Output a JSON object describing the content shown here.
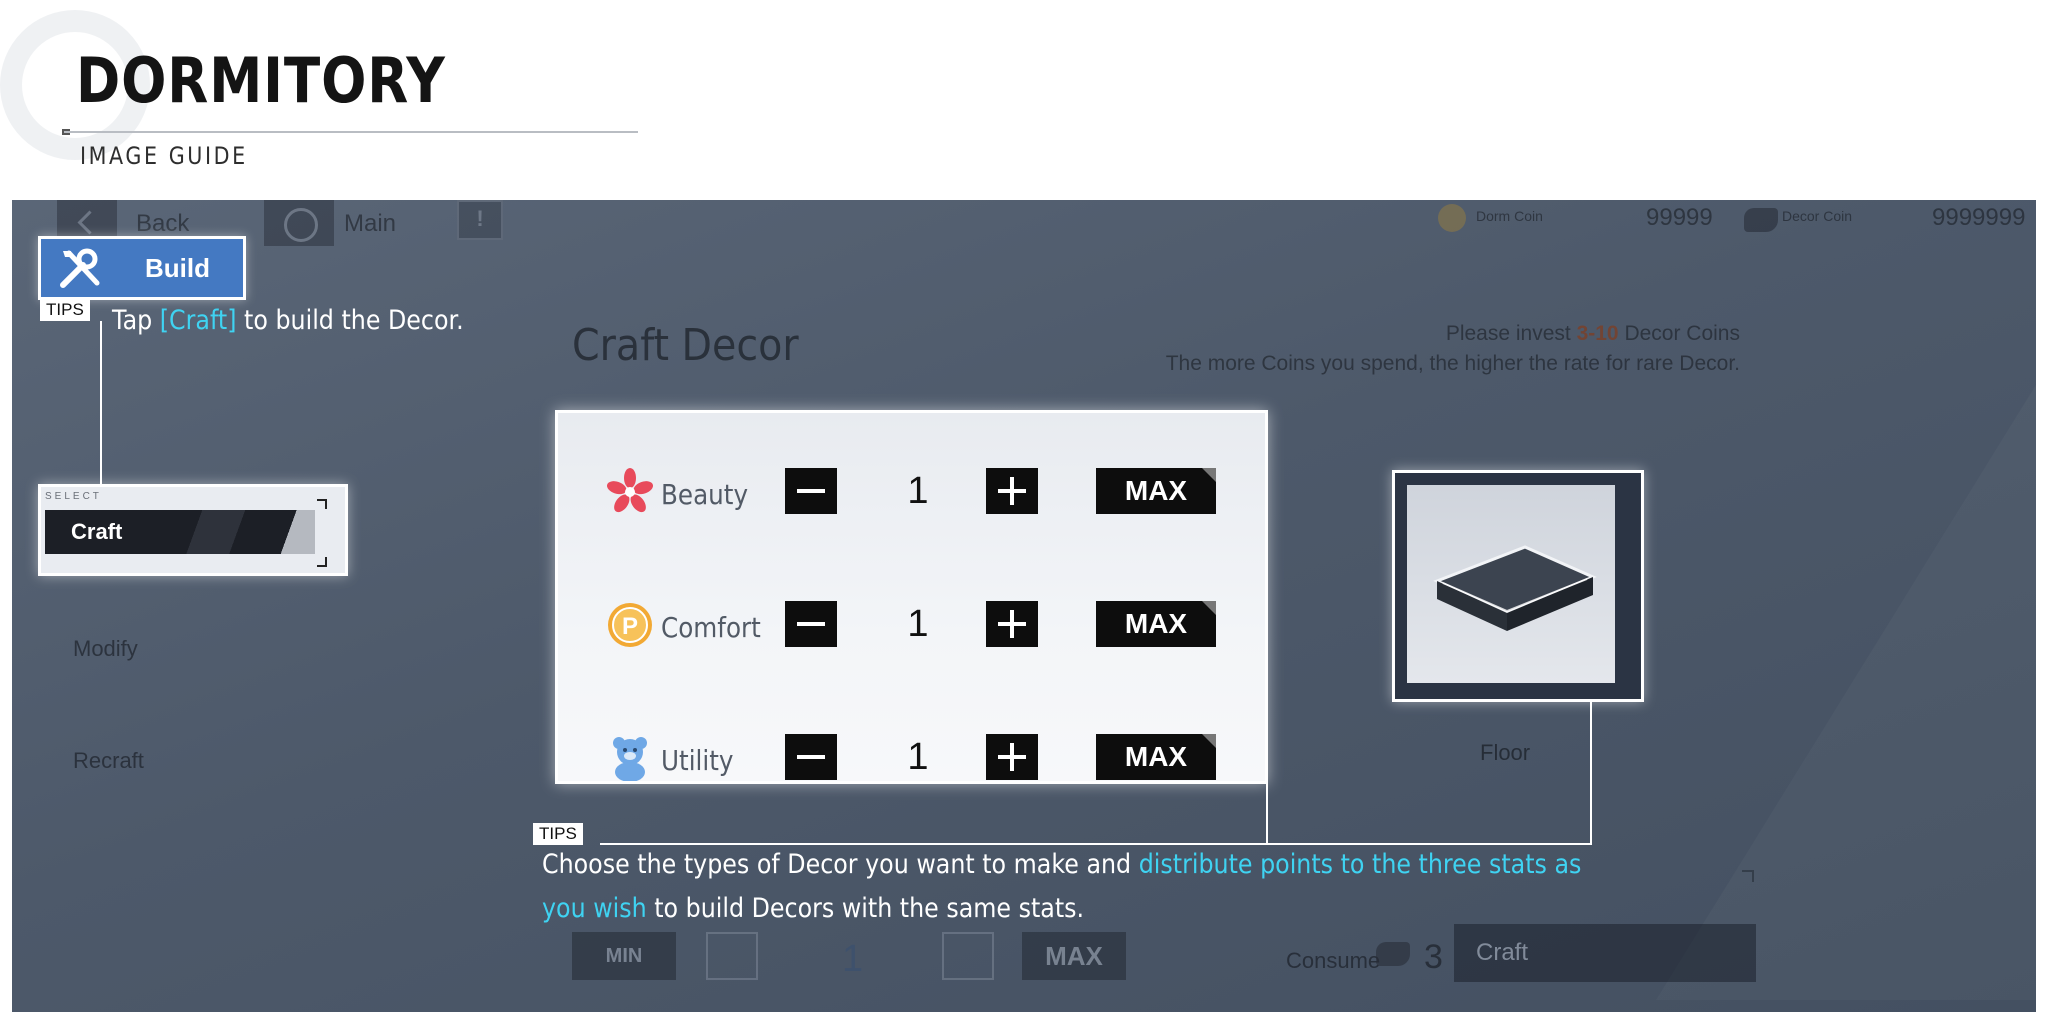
{
  "header": {
    "title": "DORMITORY",
    "subtitle": "IMAGE GUIDE"
  },
  "topbar": {
    "back_label": "Back",
    "main_label": "Main",
    "dorm_coin_label": "Dorm Coin",
    "dorm_coin_value": "99999",
    "decor_coin_label": "Decor Coin",
    "decor_coin_value": "9999999"
  },
  "sidebar": {
    "build_label": "Build",
    "select_tag": "SELECT",
    "items": [
      {
        "label": "Craft"
      },
      {
        "label": "Modify"
      },
      {
        "label": "Recraft"
      }
    ]
  },
  "tips": {
    "badge": "TIPS",
    "tip1": {
      "pre": "Tap ",
      "highlight": "[Craft]",
      "post": " to build the Decor."
    },
    "tip2": {
      "pre": "Choose the types of Decor you want to make and ",
      "highlight1": "distribute points to the three stats as",
      "highlight2": "you wish",
      "post": " to build Decors with the same stats."
    }
  },
  "craft": {
    "title": "Craft Decor",
    "hint_line1_pre": "Please invest ",
    "hint_line1_bold": "3-10",
    "hint_line1_post": " Decor Coins",
    "hint_line2": "The more Coins you spend, the higher the rate for rare Decor.",
    "stats": [
      {
        "name": "Beauty",
        "value": "1",
        "max_label": "MAX",
        "icon": "flower-icon"
      },
      {
        "name": "Comfort",
        "value": "1",
        "max_label": "MAX",
        "icon": "coin-p-icon"
      },
      {
        "name": "Utility",
        "value": "1",
        "max_label": "MAX",
        "icon": "teddy-bear-icon"
      }
    ],
    "preview_label": "Floor"
  },
  "bottom": {
    "min_label": "MIN",
    "quantity": "1",
    "max_label": "MAX",
    "consume_label": "Consume",
    "consume_qty": "3",
    "craft_button": "Craft"
  },
  "colors": {
    "highlight_text": "#3fd3f2",
    "build_blue": "#4479c2",
    "screen_bg": "#505c6d"
  }
}
